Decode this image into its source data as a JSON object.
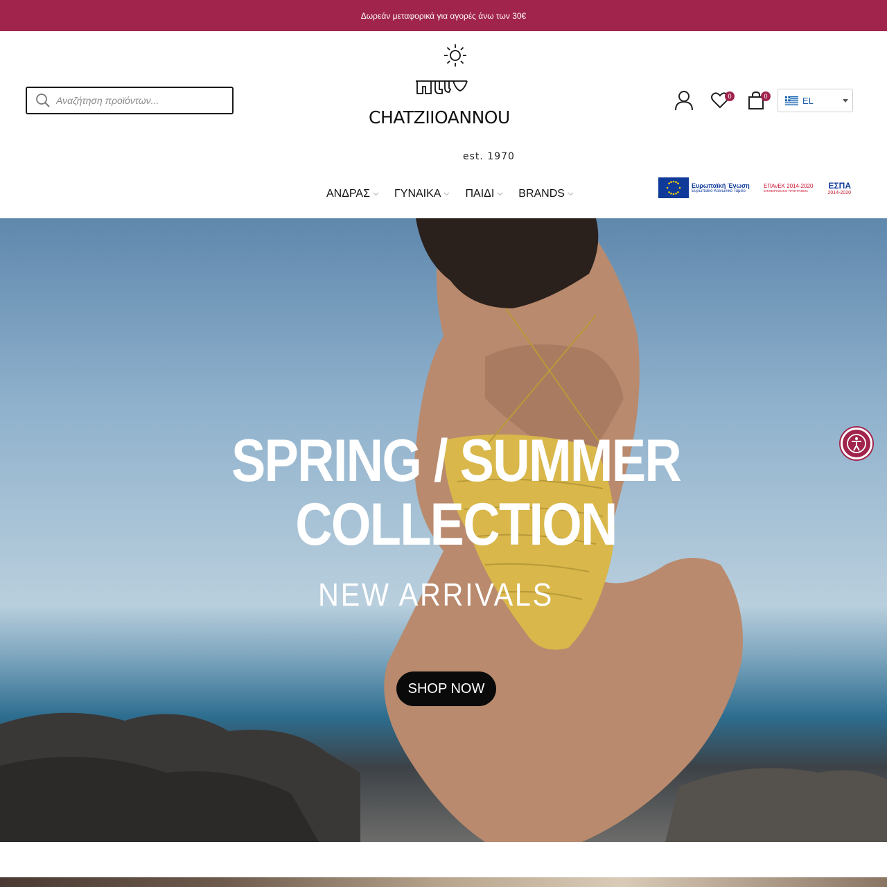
{
  "promo": {
    "text": "Δωρεάν μεταφορικά για αγορές άνω των 30€"
  },
  "search": {
    "placeholder": "Αναζήτηση προϊόντων..."
  },
  "logo": {
    "name": "CHATZIIOANNOU",
    "est": "est. 1970"
  },
  "header": {
    "wishlist_count": "0",
    "cart_count": "0",
    "language": {
      "selected": "EL",
      "flag_icon": "greek-flag-icon"
    }
  },
  "nav": {
    "items": [
      {
        "label": "ΑΝΔΡΑΣ"
      },
      {
        "label": "ΓΥΝΑΙΚΑ"
      },
      {
        "label": "ΠΑΙΔΙ"
      },
      {
        "label": "BRANDS"
      }
    ]
  },
  "eu_banner": {
    "eu_title": "Ευρωπαϊκή Ένωση",
    "eu_subtitle": "Ευρωπαϊκό Κοινωνικό Ταμείο",
    "epanek_title": "ΕΠΑνΕΚ 2014-2020",
    "epanek_subtitle": "ΕΠΙΧΕΙΡΗΣΙΑΚΟ ΠΡΟΓΡΑΜΜΑ",
    "espa_title": "ΕΣΠΑ",
    "espa_subtitle": "2014-2020"
  },
  "hero": {
    "title_line1": "SPRING / SUMMER",
    "title_line2": "COLLECTION",
    "subtitle": "NEW ARRIVALS",
    "cta_label": "SHOP NOW"
  },
  "colors": {
    "brand": "#a0244c",
    "cta": "#0a0a0a"
  }
}
